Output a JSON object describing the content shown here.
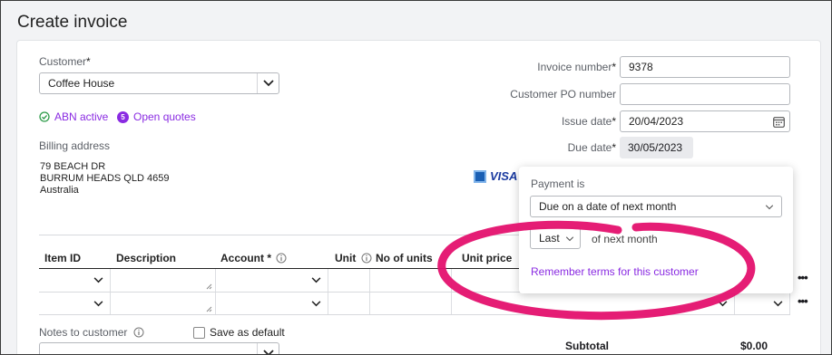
{
  "page": {
    "title": "Create invoice"
  },
  "customer": {
    "label": "Customer",
    "required_mark": "*",
    "value": "Coffee House",
    "abn_status": "ABN active",
    "open_quotes_count": "5",
    "open_quotes_label": "Open quotes"
  },
  "billing": {
    "label": "Billing address",
    "line1": "79 BEACH DR",
    "line2": "BURRUM HEADS QLD 4659",
    "line3": "Australia"
  },
  "invoice": {
    "number_label": "Invoice number",
    "number_value": "9378",
    "po_label": "Customer PO number",
    "po_value": "",
    "issue_label": "Issue date",
    "issue_value": "20/04/2023",
    "due_label": "Due date",
    "due_value": "30/05/2023",
    "required_mark": "*"
  },
  "payment_logo": {
    "text": "VISA",
    "partial": "("
  },
  "popover": {
    "title": "Payment is",
    "term_value": "Due on a date of next month",
    "day_value": "Last",
    "day_suffix": "of next month",
    "remember_link": "Remember terms for this customer"
  },
  "table": {
    "headers": {
      "item_id": "Item ID",
      "description": "Description",
      "account": "Account *",
      "unit": "Unit",
      "no_of_units": "No of units",
      "unit_price": "Unit price"
    },
    "row_actions": "•••"
  },
  "notes": {
    "label": "Notes to customer",
    "save_default": "Save as default"
  },
  "totals": {
    "subtotal_label": "Subtotal",
    "subtotal_value": "$0.00"
  },
  "colors": {
    "accent": "#8a2be2",
    "annotation": "#e4116e",
    "success": "#2e9c4a"
  }
}
